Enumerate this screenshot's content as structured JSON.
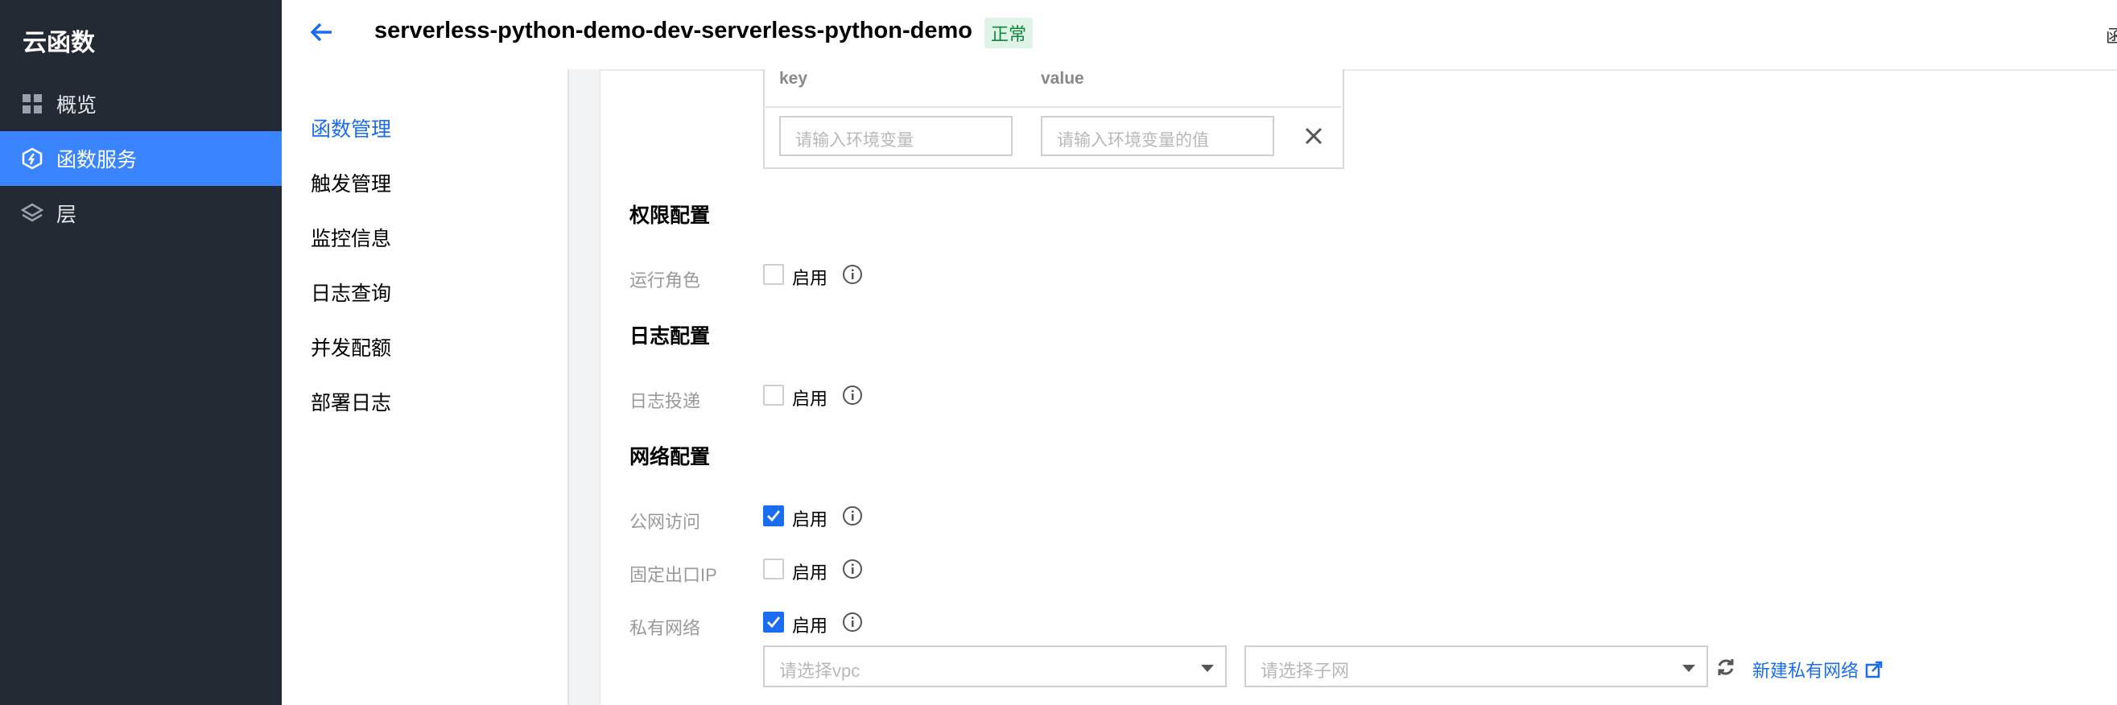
{
  "sidebar": {
    "title": "云函数",
    "items": [
      {
        "label": "概览",
        "icon": "dashboard-icon",
        "active": false
      },
      {
        "label": "函数服务",
        "icon": "function-service-icon",
        "active": true
      },
      {
        "label": "层",
        "icon": "layers-icon",
        "active": false
      }
    ]
  },
  "header": {
    "title": "serverless-python-demo-dev-serverless-python-demo",
    "status": "正常",
    "edge_glyph": "函"
  },
  "subnav": {
    "items": [
      {
        "label": "函数管理",
        "active": true
      },
      {
        "label": "触发管理",
        "active": false
      },
      {
        "label": "监控信息",
        "active": false
      },
      {
        "label": "日志查询",
        "active": false
      },
      {
        "label": "并发配额",
        "active": false
      },
      {
        "label": "部署日志",
        "active": false
      }
    ]
  },
  "env_vars": {
    "col_key": "key",
    "col_value": "value",
    "key_placeholder": "请输入环境变量",
    "value_placeholder": "请输入环境变量的值"
  },
  "permission": {
    "title": "权限配置",
    "run_role_label": "运行角色",
    "run_role_enable": "启用",
    "run_role_checked": false
  },
  "log": {
    "title": "日志配置",
    "delivery_label": "日志投递",
    "delivery_enable": "启用",
    "delivery_checked": false
  },
  "network": {
    "title": "网络配置",
    "public_label": "公网访问",
    "public_enable": "启用",
    "public_checked": true,
    "fixed_ip_label": "固定出口IP",
    "fixed_ip_enable": "启用",
    "fixed_ip_checked": false,
    "vpc_label": "私有网络",
    "vpc_enable": "启用",
    "vpc_checked": true,
    "vpc_placeholder": "请选择vpc",
    "subnet_placeholder": "请选择子网",
    "new_vpc_link": "新建私有网络"
  },
  "colors": {
    "sidebar_bg": "#242a33",
    "accent": "#1a6cf0",
    "active_item": "#3a85ff",
    "status_green": "#0b8a3c"
  }
}
